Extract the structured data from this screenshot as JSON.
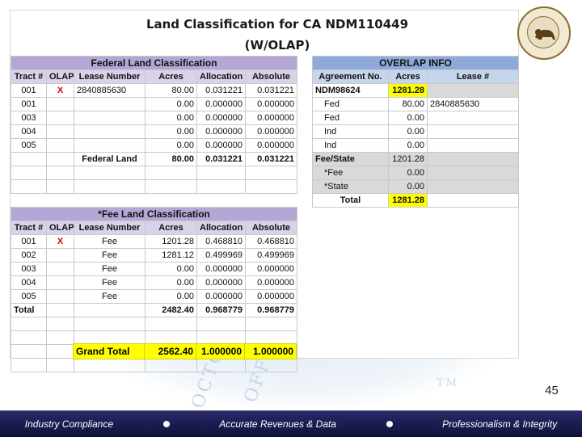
{
  "title": "Land Classification for CA NDM110449 (W/OLAP)",
  "federal": {
    "header": "Federal Land Classification",
    "columns": [
      "Tract #",
      "OLAP",
      "Lease Number",
      "Acres",
      "Allocation",
      "Absolute"
    ],
    "rows": [
      {
        "tract": "001",
        "olap": "X",
        "lease": "2840885630",
        "acres": "80.00",
        "allocation": "0.031221",
        "absolute": "0.031221"
      },
      {
        "tract": "001",
        "olap": "",
        "lease": "",
        "acres": "0.00",
        "allocation": "0.000000",
        "absolute": "0.000000"
      },
      {
        "tract": "003",
        "olap": "",
        "lease": "",
        "acres": "0.00",
        "allocation": "0.000000",
        "absolute": "0.000000"
      },
      {
        "tract": "004",
        "olap": "",
        "lease": "",
        "acres": "0.00",
        "allocation": "0.000000",
        "absolute": "0.000000"
      },
      {
        "tract": "005",
        "olap": "",
        "lease": "",
        "acres": "0.00",
        "allocation": "0.000000",
        "absolute": "0.000000"
      }
    ],
    "total": {
      "label": "Federal Land",
      "acres": "80.00",
      "allocation": "0.031221",
      "absolute": "0.031221"
    }
  },
  "fee": {
    "header": "*Fee Land Classification",
    "columns": [
      "Tract #",
      "OLAP",
      "Lease Number",
      "Acres",
      "Allocation",
      "Absolute"
    ],
    "rows": [
      {
        "tract": "001",
        "olap": "X",
        "lease": "Fee",
        "acres": "1201.28",
        "allocation": "0.468810",
        "absolute": "0.468810"
      },
      {
        "tract": "002",
        "olap": "",
        "lease": "Fee",
        "acres": "1281.12",
        "allocation": "0.499969",
        "absolute": "0.499969"
      },
      {
        "tract": "003",
        "olap": "",
        "lease": "Fee",
        "acres": "0.00",
        "allocation": "0.000000",
        "absolute": "0.000000"
      },
      {
        "tract": "004",
        "olap": "",
        "lease": "Fee",
        "acres": "0.00",
        "allocation": "0.000000",
        "absolute": "0.000000"
      },
      {
        "tract": "005",
        "olap": "",
        "lease": "Fee",
        "acres": "0.00",
        "allocation": "0.000000",
        "absolute": "0.000000"
      }
    ],
    "total": {
      "label": "Total",
      "acres": "2482.40",
      "allocation": "0.968779",
      "absolute": "0.968779"
    }
  },
  "grand_total": {
    "label": "Grand Total",
    "acres": "2562.40",
    "allocation": "1.000000",
    "absolute": "1.000000"
  },
  "overlap": {
    "header": "OVERLAP INFO",
    "columns": [
      "Agreement No.",
      "Acres",
      "Lease #"
    ],
    "agreement": {
      "name": "NDM98624",
      "acres": "1281.28",
      "lease": ""
    },
    "rows": [
      {
        "label": "Fed",
        "acres": "80.00",
        "lease": "2840885630"
      },
      {
        "label": "Fed",
        "acres": "0.00",
        "lease": ""
      },
      {
        "label": "Ind",
        "acres": "0.00",
        "lease": ""
      },
      {
        "label": "Ind",
        "acres": "0.00",
        "lease": ""
      }
    ],
    "fee_state": {
      "label": "Fee/State",
      "acres": "1201.28"
    },
    "fee": {
      "label": "*Fee",
      "acres": "0.00"
    },
    "state": {
      "label": "*State",
      "acres": "0.00"
    },
    "total": {
      "label": "Total",
      "acres": "1281.28"
    }
  },
  "watermark": {
    "text1": "OCTO",
    "text2": "OFFIC",
    "tm": "TM"
  },
  "page_number": "45",
  "footer": {
    "item1": "Industry Compliance",
    "item2": "Accurate Revenues & Data",
    "item3": "Professionalism & Integrity"
  },
  "colors": {
    "federal_header": "#b4a7d6",
    "overlap_header": "#8eaadb",
    "highlight": "#ffff00",
    "footer": "#1a1a55"
  }
}
